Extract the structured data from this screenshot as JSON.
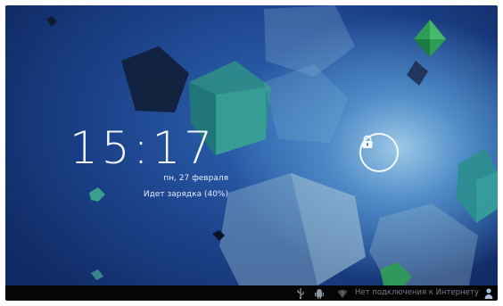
{
  "lockscreen": {
    "time": "15:17",
    "date": "пн, 27 февраля",
    "charging_status": "Идет зарядка (40%)",
    "lock_icon": "padlock-icon"
  },
  "statusbar": {
    "usb_icon": "usb-icon",
    "debug_icon": "android-debug-icon",
    "wifi_icon": "wifi-icon",
    "network_status": "Нет подключения к Интернету",
    "user_icon": "user-icon"
  },
  "colors": {
    "background_dark": "#102a63",
    "background_light": "#9ec9e6",
    "status_bar": "#050505",
    "status_text": "#6f7e8c",
    "clock_text": "#f2f6fb"
  }
}
